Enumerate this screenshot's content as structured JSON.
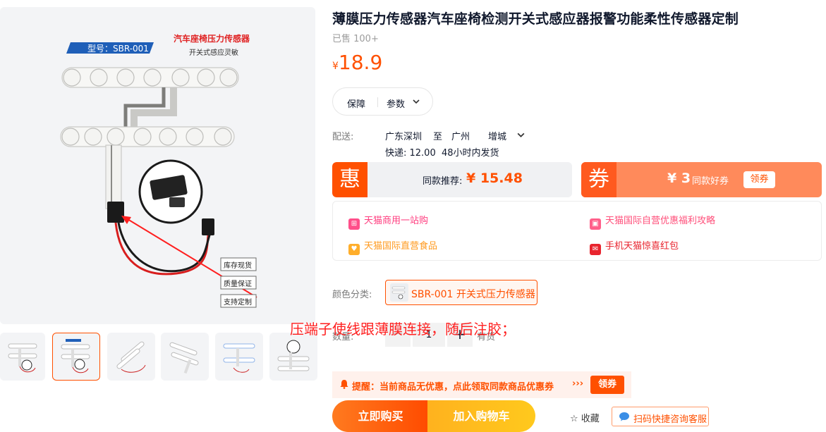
{
  "gallery": {
    "main_image": {
      "badge_text": "型号：SBR-001",
      "headline": "汽车座椅压力传感器",
      "subline": "开关式感应灵敏",
      "tags": [
        "库存现货",
        "质量保证",
        "支持定制"
      ]
    },
    "thumbnail_count": 6,
    "active_thumbnail": 2
  },
  "product": {
    "title": "薄膜压力传感器汽车座椅检测开关式感应器报警功能柔性传感器定制",
    "sold": "已售 100+",
    "price_currency": "¥",
    "price": "18.9"
  },
  "tabs": {
    "guarantee": "保障",
    "params": "参数"
  },
  "delivery": {
    "label": "配送:",
    "from": "广东深圳",
    "to_word": "至",
    "city": "广州",
    "district": "增城",
    "express": "快递: 12.00",
    "ship_time": "48小时内发货"
  },
  "promo": {
    "hui_badge": "惠",
    "hui_text": "同款推荐:",
    "hui_price": "¥ 15.48",
    "quan_badge": "券",
    "quan_amount": "¥ 3",
    "quan_desc": "同款好券",
    "quan_button": "领券"
  },
  "services": [
    {
      "label": "天猫商用一站购",
      "color": "#ff4f8a"
    },
    {
      "label": "天猫国际自营优惠福利攻略",
      "color": "#ff5f8a"
    },
    {
      "label": "天猫国际直营食品",
      "color": "#ffae2b"
    },
    {
      "label": "手机天猫惊喜红包",
      "color": "#e8242e"
    }
  ],
  "sku": {
    "label": "颜色分类:",
    "selected": "SBR-001 开关式压力传感器"
  },
  "quantity": {
    "label": "数量:",
    "value": "1",
    "stock": "有货"
  },
  "overlay_caption": "压端子使线跟薄膜连接，随后注胶；",
  "notice": {
    "text": "提醒：当前商品无优惠，点此领取同款商品优惠券",
    "arrows": "›››",
    "button": "领券"
  },
  "actions": {
    "buy_now": "立即购买",
    "add_cart": "加入购物车",
    "favorite": "收藏",
    "service": "扫码快捷咨询客服"
  },
  "colors": {
    "accent": "#ff5000",
    "annotation": "#ff1f1f"
  }
}
